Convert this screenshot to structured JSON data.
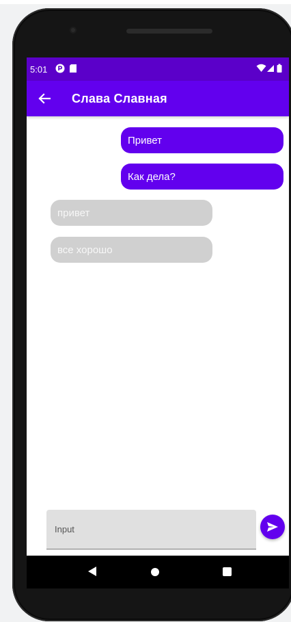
{
  "status_bar": {
    "time": "5:01",
    "icons": [
      "notification-p-icon",
      "sd-card-icon",
      "wifi-icon",
      "signal-icon",
      "battery-icon"
    ]
  },
  "app_bar": {
    "back_icon": "arrow-back-icon",
    "title": "Слава Славная"
  },
  "messages": [
    {
      "text": "Привет",
      "direction": "outgoing"
    },
    {
      "text": "Как дела?",
      "direction": "outgoing"
    },
    {
      "text": "привет",
      "direction": "incoming"
    },
    {
      "text": "все хорошо",
      "direction": "incoming"
    }
  ],
  "composer": {
    "placeholder": "Input",
    "value": "",
    "send_icon": "send-icon"
  },
  "navigation_bar": {
    "icons": [
      "back-triangle-icon",
      "home-circle-icon",
      "overview-square-icon"
    ]
  },
  "colors": {
    "primary": "#6200ee",
    "status_bar": "#5b00c9",
    "incoming_bubble": "#d0d0d0",
    "outgoing_bubble": "#6200ee",
    "input_background": "#e0e0e0"
  }
}
